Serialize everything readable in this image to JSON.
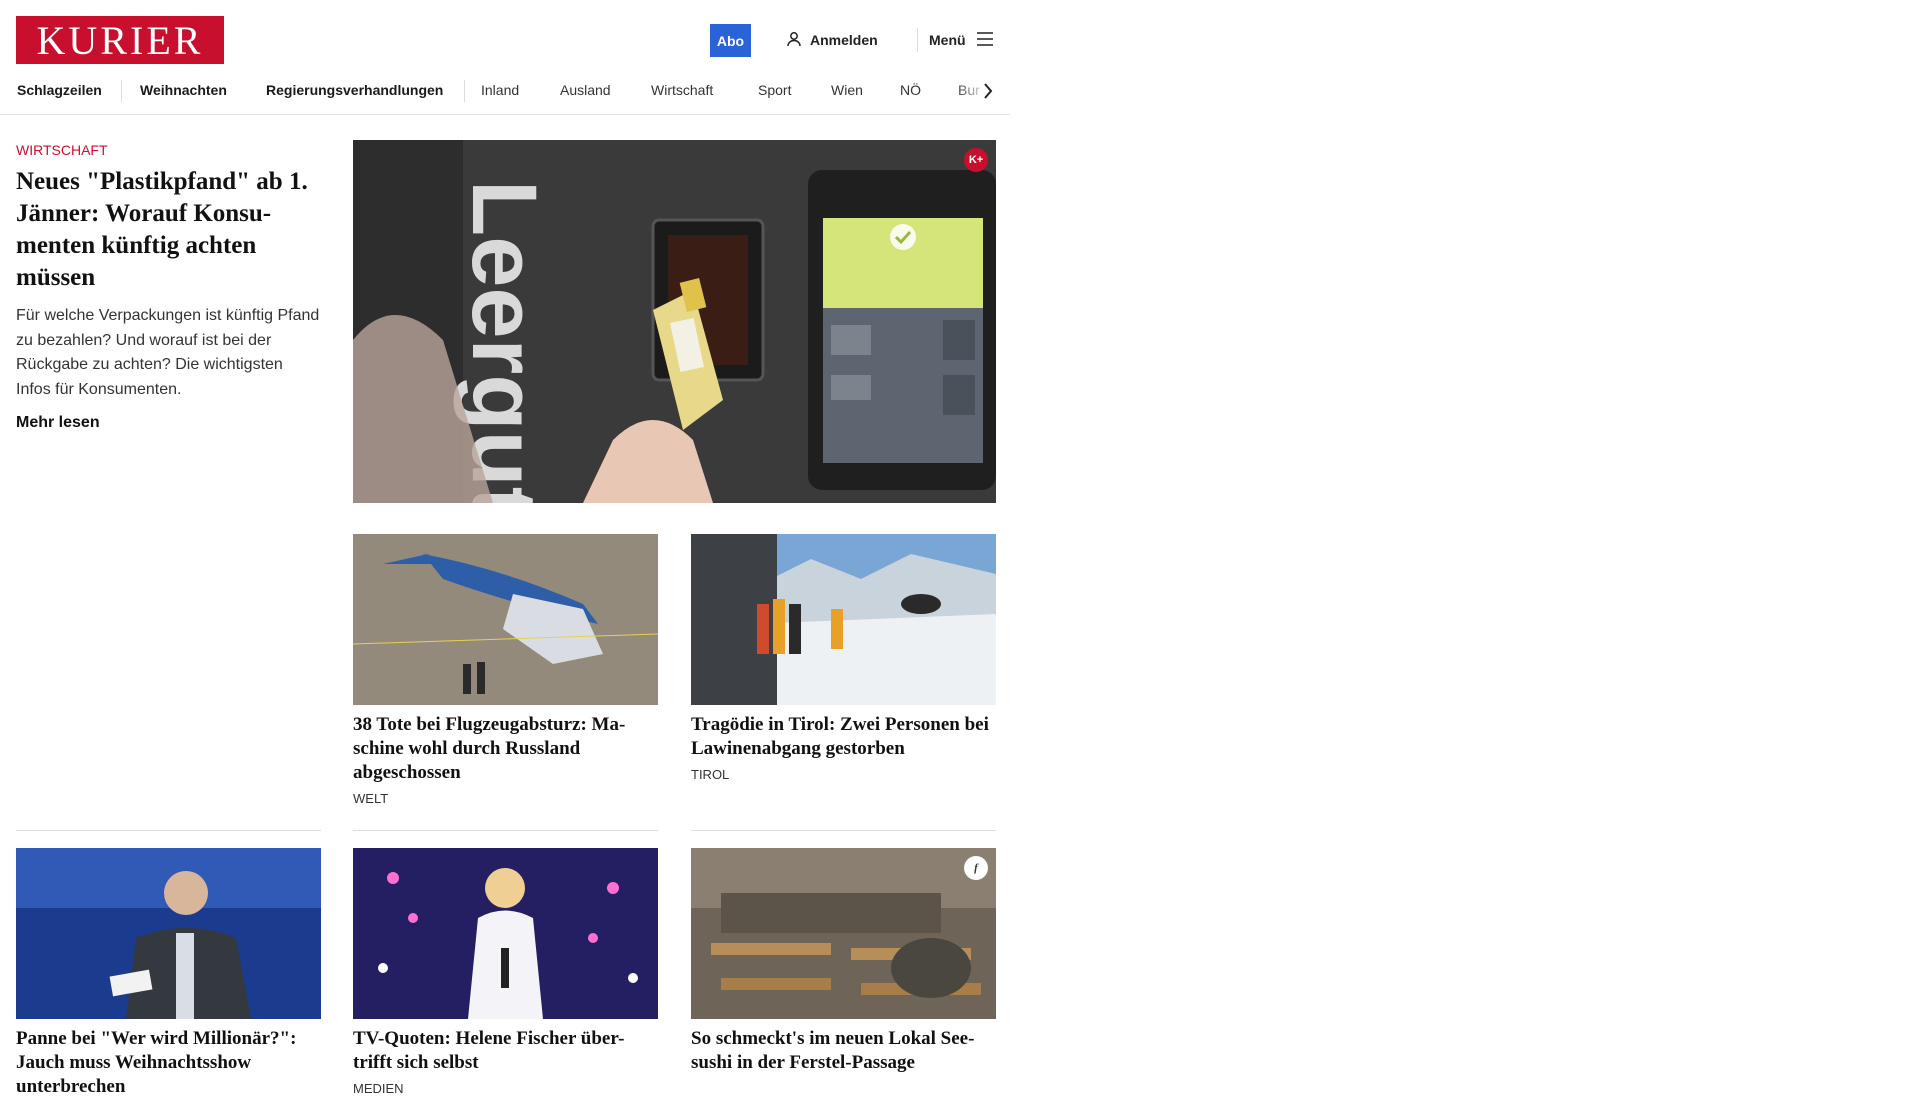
{
  "header": {
    "logo": "KURIER",
    "abo_label": "Abo",
    "login_label": "Anmelden",
    "menu_label": "Menü"
  },
  "nav": {
    "items": [
      "Schlagzeilen",
      "Weihnachten",
      "Regierungsverhandlungen",
      "Inland",
      "Ausland",
      "Wirtschaft",
      "Sport",
      "Wien",
      "NÖ",
      "Bur"
    ]
  },
  "lead": {
    "kicker": "WIRTSCHAFT",
    "title": "Neues \"Plastikpfand\" ab 1. Jänner: Worauf Konsu-menten künftig achten müssen",
    "description": "Für welche Verpackungen ist künftig Pfand zu bezahlen? Und worauf ist bei der Rückgabe zu achten? Die wichtigsten Infos für Konsumenten.",
    "more_label": "Mehr lesen",
    "badge": "K+"
  },
  "cards": [
    {
      "title": "38 Tote bei Flugzeugabsturz: Ma-schine wohl durch Russland abgeschossen",
      "tag": "WELT"
    },
    {
      "title": "Tragödie in Tirol: Zwei Personen bei Lawinenabgang gestorben",
      "tag": "TIROL"
    },
    {
      "title": "Panne bei \"Wer wird Millionär?\": Jauch muss Weihnachtsshow unterbrechen",
      "tag": ""
    },
    {
      "title": "TV-Quoten: Helene Fischer über-trifft sich selbst",
      "tag": "MEDIEN"
    },
    {
      "title": "So schmeckt's im neuen Lokal See-sushi in der Ferstel-Passage",
      "tag": "",
      "badge": "f"
    }
  ],
  "colors": {
    "brand": "#c8102e",
    "abo": "#2a62d8"
  }
}
